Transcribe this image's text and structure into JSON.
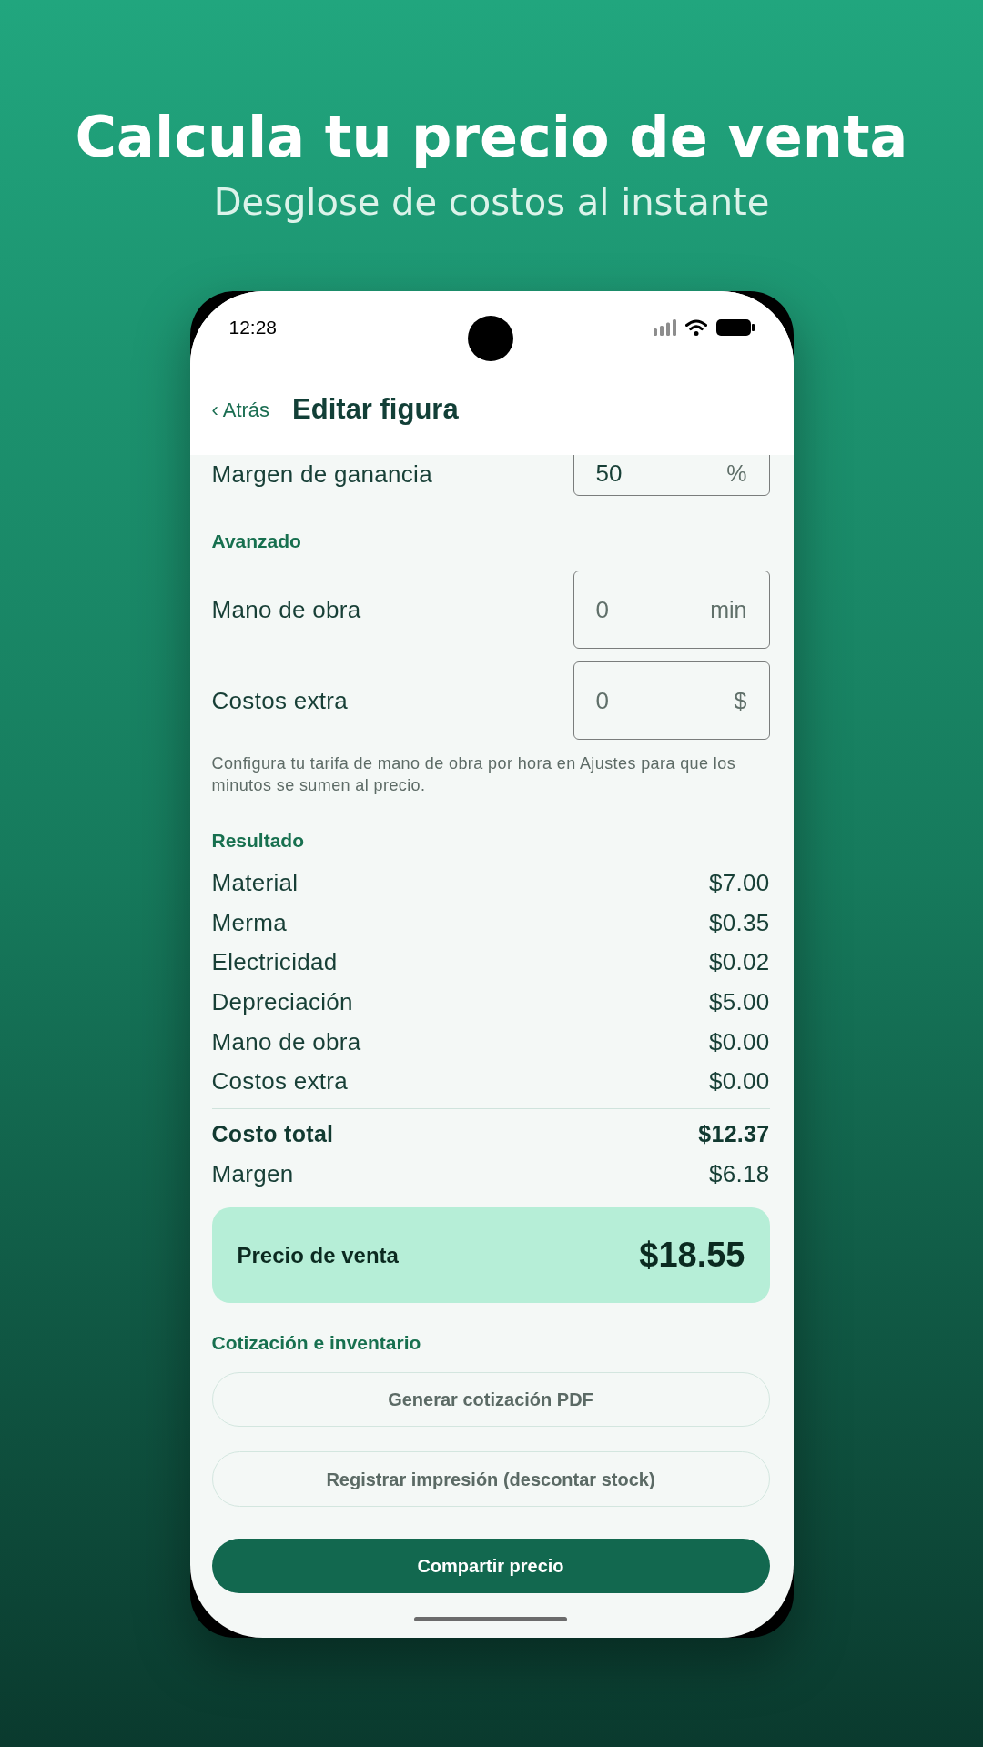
{
  "headline": {
    "title": "Calcula tu precio de venta",
    "subtitle": "Desglose de costos al instante"
  },
  "status_bar": {
    "time": "12:28"
  },
  "header": {
    "back": "‹ Atrás",
    "title": "Editar figura"
  },
  "pricing_fields": [
    {
      "label": "Margen de ganancia",
      "value": "50",
      "unit": "%"
    }
  ],
  "advanced": {
    "heading": "Avanzado",
    "fields": [
      {
        "label": "Mano de obra",
        "placeholder": "0",
        "unit": "min"
      },
      {
        "label": "Costos extra",
        "placeholder": "0",
        "unit": "$"
      }
    ],
    "note": "Configura tu tarifa de mano de obra por hora en Ajustes para que los minutos se sumen al precio."
  },
  "result": {
    "heading": "Resultado",
    "rows": [
      {
        "kind": "item",
        "label": "Material",
        "value": "$7.00"
      },
      {
        "kind": "item",
        "label": "Merma",
        "value": "$0.35"
      },
      {
        "kind": "item",
        "label": "Electricidad",
        "value": "$0.02"
      },
      {
        "kind": "item",
        "label": "Depreciación",
        "value": "$5.00"
      },
      {
        "kind": "item",
        "label": "Mano de obra",
        "value": "$0.00"
      },
      {
        "kind": "item",
        "label": "Costos extra",
        "value": "$0.00"
      },
      {
        "kind": "divider"
      },
      {
        "kind": "total",
        "label": "Costo total",
        "value": "$12.37"
      },
      {
        "kind": "item",
        "label": "Margen",
        "value": "$6.18"
      }
    ]
  },
  "price": {
    "label": "Precio de venta",
    "value": "$18.55"
  },
  "actions": {
    "heading": "Cotización e inventario",
    "buttons": [
      {
        "kind": "outline",
        "label": "Generar cotización PDF"
      },
      {
        "kind": "outline",
        "label": "Registrar impresión (descontar stock)"
      },
      {
        "kind": "primary",
        "label": "Compartir precio"
      }
    ]
  }
}
